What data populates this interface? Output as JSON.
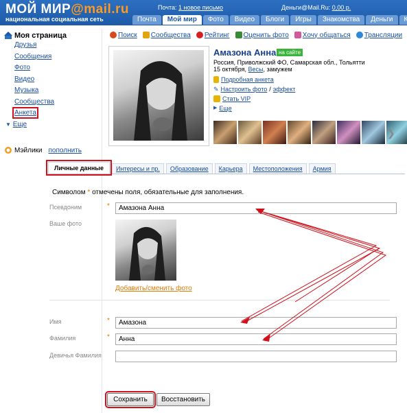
{
  "header": {
    "logo_main": "МОЙ МИР",
    "logo_domain": "@mail.ru",
    "tagline": "национальная социальная сеть",
    "mail_label": "Почта:",
    "mail_link": "1 новое письмо",
    "money_label": "Деньги@Mail.Ru:",
    "money_value": "0,00 р.",
    "tabs": [
      "Почта",
      "Мой мир",
      "Фото",
      "Видео",
      "Блоги",
      "Игры",
      "Знакомства",
      "Деньги",
      "К"
    ]
  },
  "sidebar": {
    "title": "Моя страница",
    "items": [
      "Друзья",
      "Сообщения",
      "Фото",
      "Видео",
      "Музыка",
      "Сообщества",
      "Анкета"
    ],
    "more": "Еще",
    "wallet_label": "Мэйлики",
    "wallet_link": "пополнить"
  },
  "actions": [
    "Поиск",
    "Сообщества",
    "Рейтинг",
    "Оценить фото",
    "Хочу общаться",
    "Трансляции"
  ],
  "profile": {
    "name": "Амазона Анна",
    "online_badge": "на сайте",
    "location": "Россия, Приволжский ФО, Самарская обл., Тольятти",
    "birth": "15 октября,",
    "zodiac": "Весы",
    "status": ", замужем",
    "links": {
      "detailed": "Подробная анкета",
      "setup_photo": "Настроить фото",
      "effect": "эффект",
      "vip": "Стать VIP",
      "more": "Еще"
    }
  },
  "form": {
    "tabs": [
      "Личные данные",
      "Интересы и пр.",
      "Образование",
      "Карьера",
      "Местоположения",
      "Армия"
    ],
    "required_note_prefix": "Символом",
    "required_note_suffix": "отмечены поля, обязательные для заполнения.",
    "nickname_label": "Псевдоним",
    "nickname_value": "Амазона Анна",
    "photo_label": "Ваше фото",
    "change_photo": "Добавить/сменить фото",
    "first_name_label": "Имя",
    "first_name_value": "Амазона",
    "last_name_label": "Фамилия",
    "last_name_value": "Анна",
    "maiden_label": "Девичья Фамилия",
    "maiden_value": "",
    "save_label": "Сохранить",
    "restore_label": "Восстановить"
  },
  "colors": {
    "header_blue": "#1c5aa8",
    "link_blue": "#1a4fa0",
    "highlight_red": "#d0101a",
    "online_green": "#3ab43a",
    "required_orange": "#e07a00"
  }
}
